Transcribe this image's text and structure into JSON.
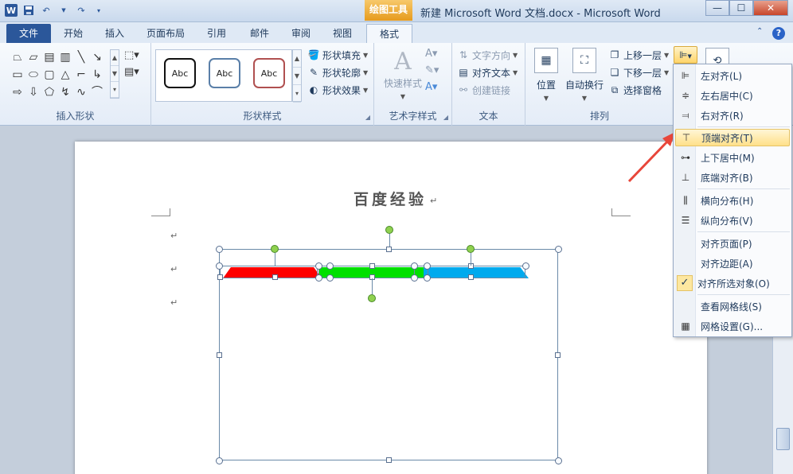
{
  "titlebar": {
    "window_title": "新建 Microsoft Word 文档.docx - Microsoft Word",
    "contextual_tab": "绘图工具",
    "minimize": "—",
    "maximize": "☐",
    "close": "✕"
  },
  "tabs": [
    {
      "label": "文件"
    },
    {
      "label": "开始"
    },
    {
      "label": "插入"
    },
    {
      "label": "页面布局"
    },
    {
      "label": "引用"
    },
    {
      "label": "邮件"
    },
    {
      "label": "审阅"
    },
    {
      "label": "视图"
    },
    {
      "label": "格式"
    }
  ],
  "ribbon": {
    "groups": {
      "insert_shapes": "插入形状",
      "shape_styles": "形状样式",
      "wordart_styles": "艺术字样式",
      "text": "文本",
      "arrange": "排列"
    },
    "style_samples": [
      "Abc",
      "Abc",
      "Abc"
    ],
    "shape_fill": "形状填充",
    "shape_outline": "形状轮廓",
    "shape_effects": "形状效果",
    "quick_styles": "快速样式",
    "text_direction": "文字方向",
    "align_text": "对齐文本",
    "create_link": "创建链接",
    "position": "位置",
    "wrap_text": "自动换行",
    "bring_forward": "上移一层",
    "send_backward": "下移一层",
    "selection_pane": "选择窗格"
  },
  "document": {
    "title": "百度经验"
  },
  "align_menu": {
    "items": [
      {
        "label": "左对齐(L)"
      },
      {
        "label": "左右居中(C)"
      },
      {
        "label": "右对齐(R)"
      },
      {
        "label": "顶端对齐(T)"
      },
      {
        "label": "上下居中(M)"
      },
      {
        "label": "底端对齐(B)"
      },
      {
        "label": "横向分布(H)"
      },
      {
        "label": "纵向分布(V)"
      },
      {
        "label": "对齐页面(P)"
      },
      {
        "label": "对齐边距(A)"
      },
      {
        "label": "对齐所选对象(O)"
      },
      {
        "label": "查看网格线(S)"
      },
      {
        "label": "网格设置(G)..."
      }
    ],
    "checkmark": "✓"
  },
  "colors": {
    "bar_red": "#ff0000",
    "bar_green": "#00e000",
    "bar_blue": "#00aaee",
    "accent_blue": "#2b579a",
    "arrow_red": "#e8463a"
  }
}
